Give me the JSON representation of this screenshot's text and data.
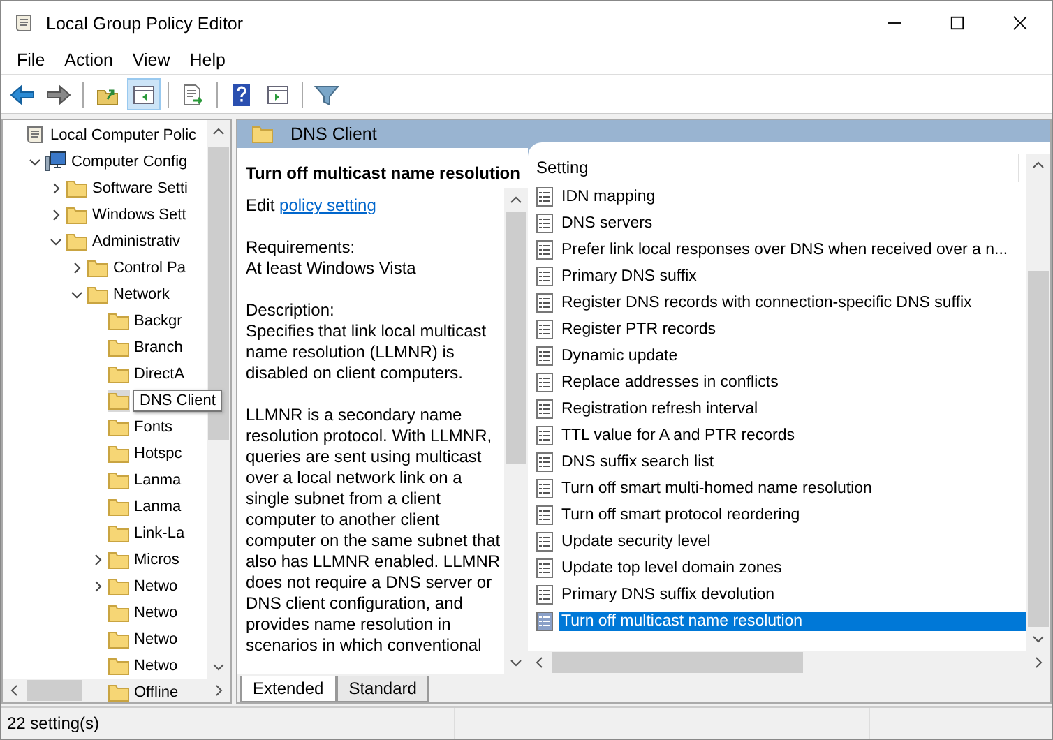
{
  "window": {
    "title": "Local Group Policy Editor"
  },
  "menu": [
    "File",
    "Action",
    "View",
    "Help"
  ],
  "toolbar": [
    {
      "kind": "back",
      "disabled": false,
      "pressed": false
    },
    {
      "kind": "forward",
      "disabled": true,
      "pressed": false
    },
    {
      "kind": "sep"
    },
    {
      "kind": "up",
      "pressed": false
    },
    {
      "kind": "tree",
      "pressed": true
    },
    {
      "kind": "sep"
    },
    {
      "kind": "export",
      "pressed": false
    },
    {
      "kind": "sep"
    },
    {
      "kind": "help",
      "pressed": false
    },
    {
      "kind": "action",
      "pressed": false
    },
    {
      "kind": "sep"
    },
    {
      "kind": "filter",
      "pressed": false
    }
  ],
  "tree": [
    {
      "label": "Local Computer Polic",
      "kind": "policy",
      "selected": false,
      "children": [
        {
          "label": "Computer Config",
          "kind": "computer",
          "expanded": true,
          "selected": false,
          "children": [
            {
              "label": "Software Setti",
              "kind": "folder",
              "expanded": false,
              "selected": false
            },
            {
              "label": "Windows Sett",
              "kind": "folder",
              "expanded": false,
              "selected": false
            },
            {
              "label": "Administrativ",
              "kind": "folder",
              "expanded": true,
              "selected": false,
              "children": [
                {
                  "label": "Control Pa",
                  "kind": "folder",
                  "expanded": false,
                  "selected": false
                },
                {
                  "label": "Network",
                  "kind": "folder",
                  "expanded": true,
                  "selected": false,
                  "children": [
                    {
                      "label": "Backgr",
                      "kind": "folder",
                      "selected": false
                    },
                    {
                      "label": "Branch",
                      "kind": "folder",
                      "selected": false
                    },
                    {
                      "label": "DirectA",
                      "kind": "folder",
                      "selected": false
                    },
                    {
                      "label": "DNS Client",
                      "kind": "folder",
                      "selected": true
                    },
                    {
                      "label": "Fonts",
                      "kind": "folder",
                      "selected": false
                    },
                    {
                      "label": "Hotspc",
                      "kind": "folder",
                      "selected": false
                    },
                    {
                      "label": "Lanma",
                      "kind": "folder",
                      "selected": false
                    },
                    {
                      "label": "Lanma",
                      "kind": "folder",
                      "selected": false
                    },
                    {
                      "label": "Link-La",
                      "kind": "folder",
                      "selected": false
                    },
                    {
                      "label": "Micros",
                      "kind": "folder",
                      "expanded": false,
                      "selected": false
                    },
                    {
                      "label": "Netwo",
                      "kind": "folder",
                      "expanded": false,
                      "selected": false
                    },
                    {
                      "label": "Netwo",
                      "kind": "folder",
                      "selected": false
                    },
                    {
                      "label": "Netwo",
                      "kind": "folder",
                      "selected": false
                    },
                    {
                      "label": "Netwo",
                      "kind": "folder",
                      "selected": false
                    },
                    {
                      "label": "Offline",
                      "kind": "folder",
                      "selected": false
                    }
                  ]
                }
              ]
            }
          ]
        }
      ]
    }
  ],
  "pane": {
    "title": "DNS Client"
  },
  "description": {
    "title": "Turn off multicast name resolution",
    "edit_prefix": "Edit",
    "edit_link": "policy setting",
    "requirements_label": "Requirements:",
    "requirements": "At least Windows Vista",
    "description_label": "Description:",
    "paragraphs": [
      "Specifies that link local multicast name resolution (LLMNR) is disabled on client computers.",
      "LLMNR is a secondary name resolution protocol. With LLMNR, queries are sent using multicast over a local network link on a single subnet from a client computer to another client computer on the same subnet that also has LLMNR enabled. LLMNR does not require a DNS server or DNS client configuration, and provides name resolution in scenarios in which conventional"
    ]
  },
  "settings": {
    "column": "Setting",
    "rows": [
      {
        "name": "IDN mapping",
        "selected": false
      },
      {
        "name": "DNS servers",
        "selected": false
      },
      {
        "name": "Prefer link local responses over DNS when received over a n...",
        "selected": false
      },
      {
        "name": "Primary DNS suffix",
        "selected": false
      },
      {
        "name": "Register DNS records with connection-specific DNS suffix",
        "selected": false
      },
      {
        "name": "Register PTR records",
        "selected": false
      },
      {
        "name": "Dynamic update",
        "selected": false
      },
      {
        "name": "Replace addresses in conflicts",
        "selected": false
      },
      {
        "name": "Registration refresh interval",
        "selected": false
      },
      {
        "name": "TTL value for A and PTR records",
        "selected": false
      },
      {
        "name": "DNS suffix search list",
        "selected": false
      },
      {
        "name": "Turn off smart multi-homed name resolution",
        "selected": false
      },
      {
        "name": "Turn off smart protocol reordering",
        "selected": false
      },
      {
        "name": "Update security level",
        "selected": false
      },
      {
        "name": "Update top level domain zones",
        "selected": false
      },
      {
        "name": "Primary DNS suffix devolution",
        "selected": false
      },
      {
        "name": "Turn off multicast name resolution",
        "selected": true
      }
    ]
  },
  "tabs": [
    {
      "label": "Extended",
      "selected": true
    },
    {
      "label": "Standard",
      "selected": false
    }
  ],
  "status_bar": "22 setting(s)"
}
